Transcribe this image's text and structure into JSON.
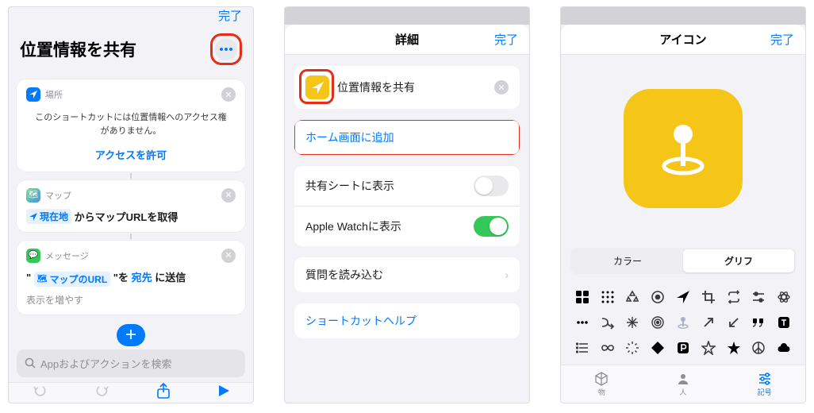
{
  "common": {
    "done": "完了"
  },
  "screen1": {
    "title": "位置情報を共有",
    "card1": {
      "chip": "場所",
      "body": "このショートカットには位置情報へのアクセス権がありません。",
      "allow": "アクセスを許可"
    },
    "card2": {
      "chip": "マップ",
      "prefix_token": "現在地",
      "middle": " からマップURLを取得"
    },
    "card3": {
      "chip": "メッセージ",
      "q1": "\"",
      "token": "マップのURL",
      "q2": "\"を ",
      "recipient": "宛先",
      "tail": " に送信",
      "sub": "表示を増やす"
    },
    "search_placeholder": "Appおよびアクションを検索"
  },
  "screen2": {
    "title": "詳細",
    "name": "位置情報を共有",
    "add_home": "ホーム画面に追加",
    "share_sheet": "共有シートに表示",
    "apple_watch": "Apple Watchに表示",
    "import_q": "質問を読み込む",
    "help": "ショートカットヘルプ"
  },
  "screen3": {
    "title": "アイコン",
    "seg_color": "カラー",
    "seg_glyph": "グリフ",
    "tabs": {
      "objects": "物",
      "people": "人",
      "symbols": "記号"
    }
  }
}
